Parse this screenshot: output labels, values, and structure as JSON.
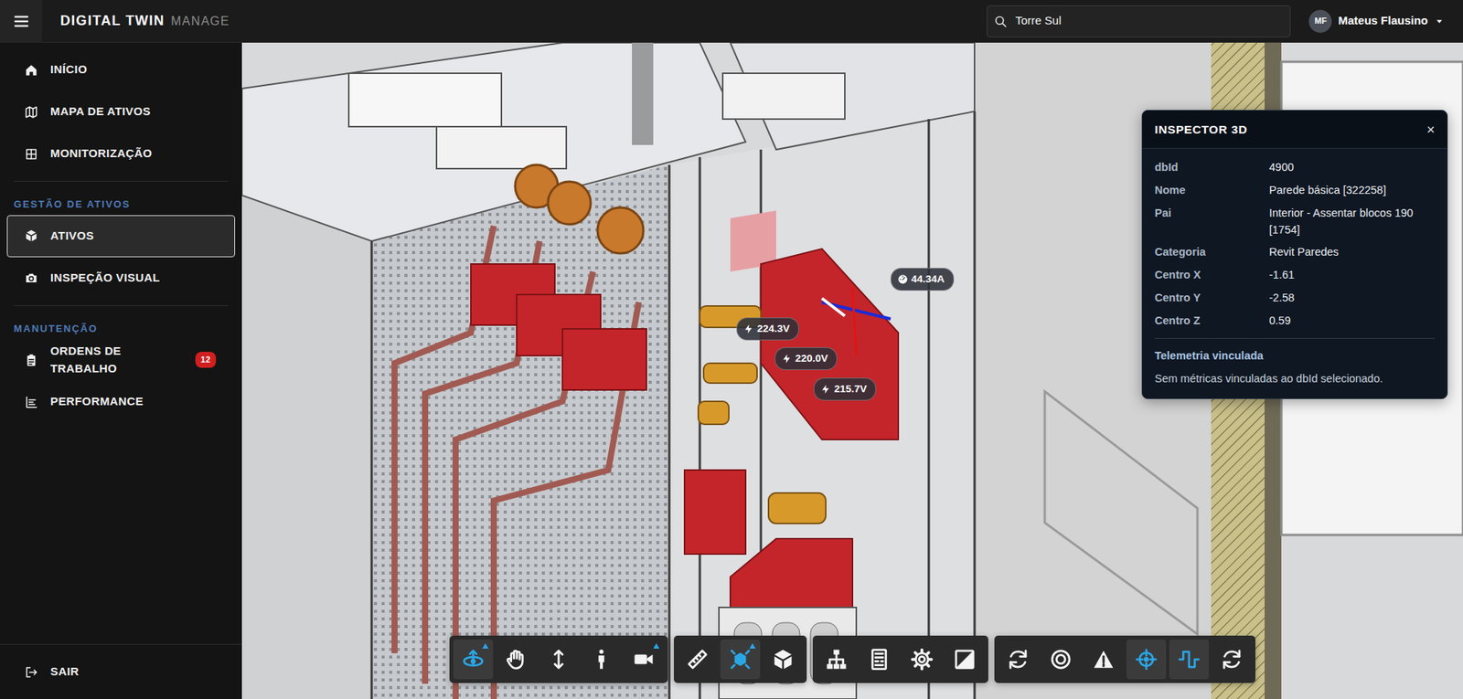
{
  "header": {
    "title": "DIGITAL TWIN",
    "subtitle": "MANAGE"
  },
  "search": {
    "value": "Torre Sul"
  },
  "user": {
    "initials": "MF",
    "name": "Mateus Flausino"
  },
  "sidebar": {
    "groups": [
      {
        "items": [
          {
            "label": "INÍCIO",
            "selected": false
          },
          {
            "label": "MAPA DE ATIVOS",
            "selected": false
          },
          {
            "label": "MONITORIZAÇÃO",
            "selected": false
          }
        ]
      },
      {
        "label": "GESTÃO DE ATIVOS",
        "items": [
          {
            "label": "ATIVOS",
            "selected": true
          },
          {
            "label": "INSPEÇÃO VISUAL",
            "selected": false
          }
        ]
      },
      {
        "label": "MANUTENÇÃO",
        "items": [
          {
            "label": "ORDENS DE TRABALHO",
            "selected": false,
            "badge": "12"
          },
          {
            "label": "PERFORMANCE",
            "selected": false
          }
        ]
      }
    ],
    "footer": {
      "label": "SAIR"
    }
  },
  "viewer": {
    "tags": [
      {
        "text": "44.34A",
        "kind": "current"
      },
      {
        "text": "224.3V",
        "kind": "voltage"
      },
      {
        "text": "220.0V",
        "kind": "voltage"
      },
      {
        "text": "215.7V",
        "kind": "voltage"
      }
    ]
  },
  "inspector": {
    "title": "INSPECTOR 3D",
    "close": "×",
    "fields": [
      {
        "label": "dbId",
        "value": "4900"
      },
      {
        "label": "Nome",
        "value": "Parede básica [322258]"
      },
      {
        "label": "Pai",
        "value": "Interior - Assentar blocos 190 [1754]"
      },
      {
        "label": "Categoria",
        "value": "Revit Paredes"
      },
      {
        "label": "Centro X",
        "value": "-1.61"
      },
      {
        "label": "Centro Y",
        "value": "-2.58"
      },
      {
        "label": "Centro Z",
        "value": "0.59"
      }
    ],
    "telemetry": {
      "title": "Telemetria vinculada",
      "message": "Sem métricas vinculadas ao dbId selecionado."
    }
  },
  "toolbar": {
    "groups": [
      [
        {
          "active": true,
          "submenu": true
        },
        {
          "active": false,
          "submenu": false
        },
        {
          "active": false,
          "submenu": false
        },
        {
          "active": false,
          "submenu": false
        },
        {
          "active": false,
          "submenu": true
        }
      ],
      [
        {
          "active": false,
          "submenu": false
        },
        {
          "active": true,
          "submenu": true
        },
        {
          "active": false,
          "submenu": false
        }
      ],
      [
        {
          "active": false,
          "submenu": false
        },
        {
          "active": false,
          "submenu": false
        },
        {
          "active": false,
          "submenu": false
        },
        {
          "active": false,
          "submenu": false
        }
      ],
      [
        {
          "active": false,
          "submenu": false
        },
        {
          "active": false,
          "submenu": false
        },
        {
          "active": false,
          "submenu": false
        },
        {
          "active": true,
          "submenu": false
        },
        {
          "active": true,
          "submenu": false
        },
        {
          "active": false,
          "submenu": false
        }
      ]
    ]
  }
}
